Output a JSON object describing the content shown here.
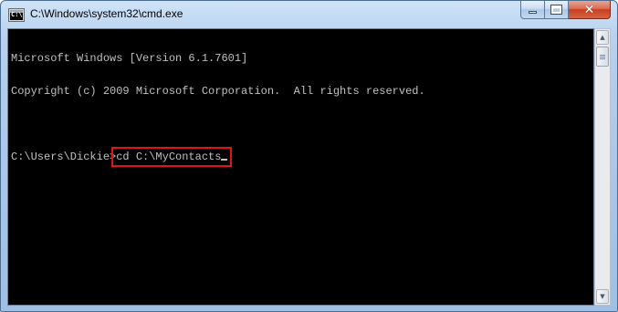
{
  "window": {
    "title": "C:\\Windows\\system32\\cmd.exe",
    "icon": "cmd-icon",
    "icon_text": "C:\\"
  },
  "caption_buttons": {
    "minimize_icon": "minimize-icon",
    "maximize_icon": "maximize-icon",
    "close_icon": "close-icon",
    "close_glyph": "✕"
  },
  "console": {
    "lines": [
      "Microsoft Windows [Version 6.1.7601]",
      "Copyright (c) 2009 Microsoft Corporation.  All rights reserved."
    ],
    "prompt": "C:\\Users\\Dickie>",
    "command": "cd C:\\MyContacts",
    "text_color": "#c0c0c0",
    "background_color": "#000000",
    "highlight_color": "#e0121a"
  },
  "scrollbar": {
    "up_arrow": "▲",
    "down_arrow": "▼"
  }
}
